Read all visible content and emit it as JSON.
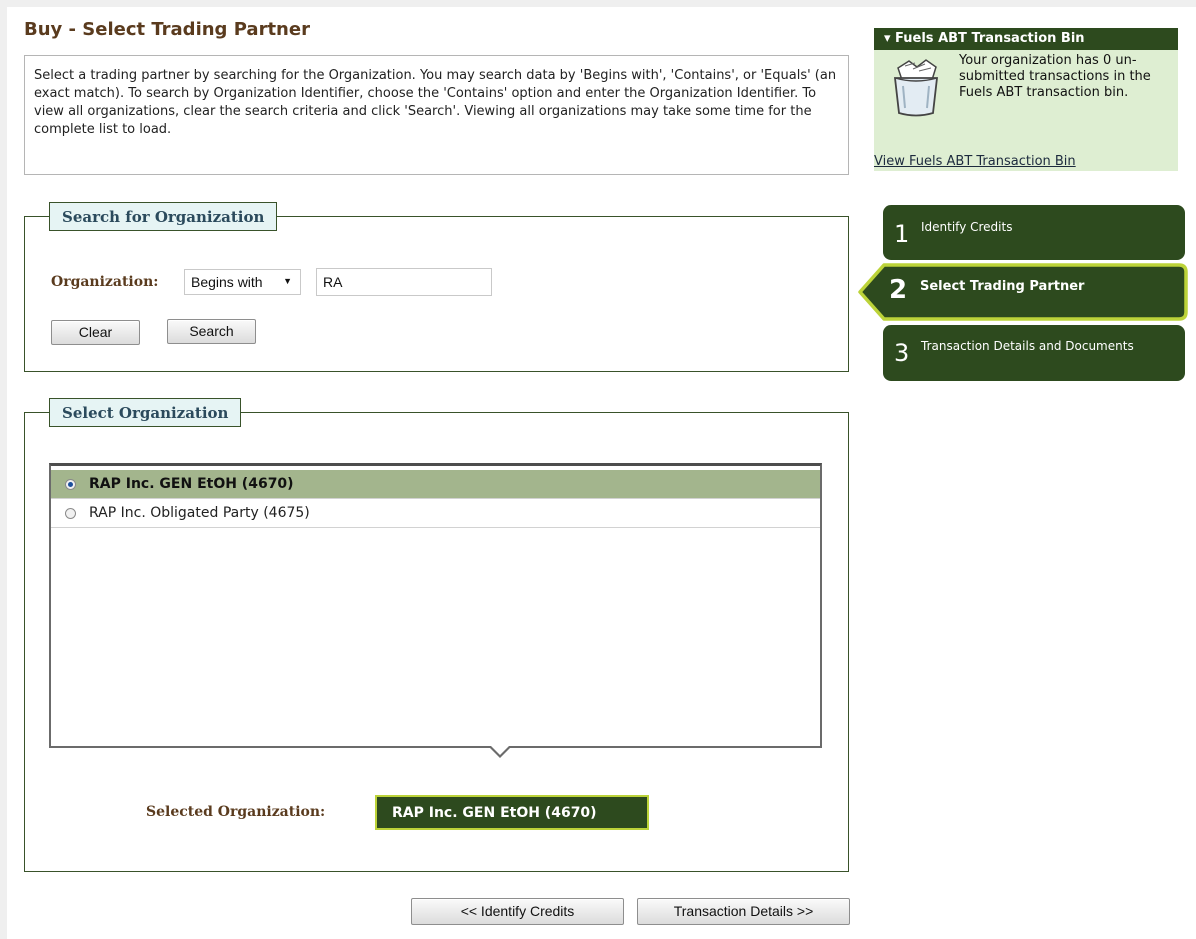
{
  "page": {
    "title": "Buy - Select Trading Partner",
    "instructions": "Select a trading partner by searching for the Organization. You may search data by 'Begins with', 'Contains', or 'Equals' (an exact match). To search by Organization Identifier, choose the 'Contains' option and enter the Organization Identifier. To view all organizations, clear the search criteria and click 'Search'. Viewing all organizations may take some time for the complete list to load."
  },
  "search": {
    "legend": "Search for Organization",
    "org_label": "Organization:",
    "match_mode": "Begins with",
    "query": "RA",
    "clear_label": "Clear",
    "search_label": "Search"
  },
  "select": {
    "legend": "Select Organization",
    "options": [
      {
        "label": "RAP Inc. GEN EtOH (4670)",
        "selected": true
      },
      {
        "label": "RAP Inc. Obligated Party (4675)",
        "selected": false
      }
    ],
    "selected_label": "Selected Organization:",
    "selected_value": "RAP Inc. GEN EtOH (4670)"
  },
  "nav": {
    "prev_label": "<< Identify Credits",
    "next_label": "Transaction Details >>"
  },
  "bin": {
    "header": "▾ Fuels ABT Transaction Bin",
    "message": "Your organization has 0 un-submitted transactions in the Fuels ABT transaction bin.",
    "link": "View Fuels ABT Transaction Bin"
  },
  "steps": [
    {
      "number": "1",
      "label": "Identify Credits"
    },
    {
      "number": "2",
      "label": "Select Trading Partner"
    },
    {
      "number": "3",
      "label": "Transaction Details and Documents"
    }
  ],
  "colors": {
    "dark_green": "#2d4a1e",
    "active_border": "#bcd339",
    "selected_row": "#a3b58d",
    "bin_bg": "#deeed2",
    "title_brown": "#5a3b1e"
  }
}
